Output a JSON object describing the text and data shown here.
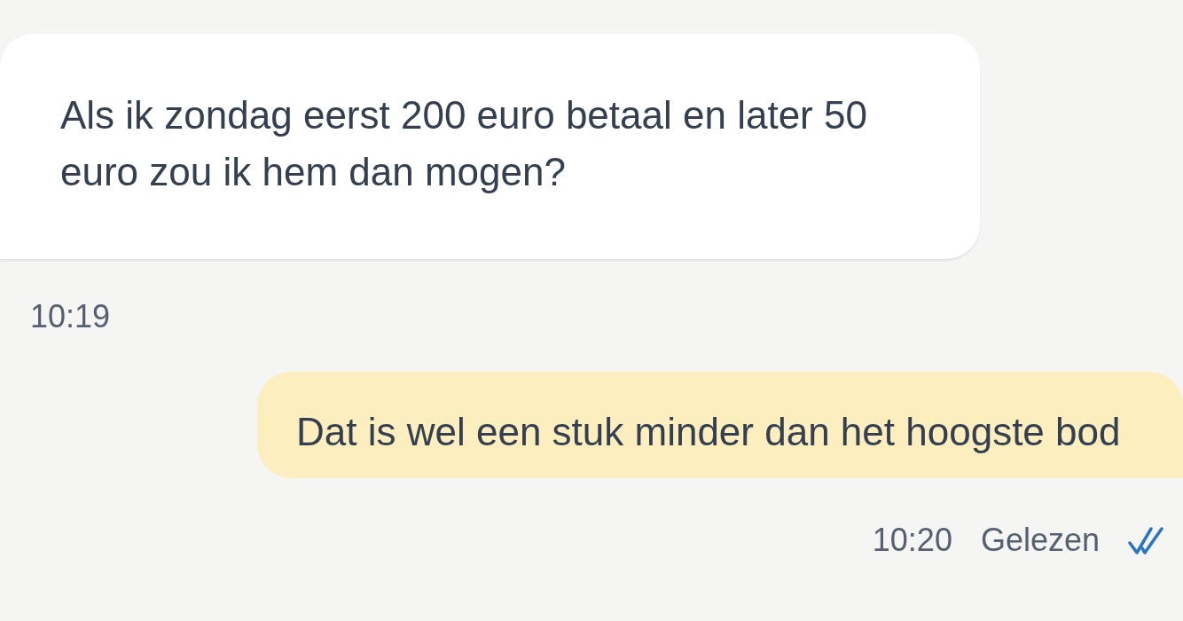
{
  "messages": [
    {
      "kind": "incoming",
      "text": "Als ik zondag eerst 200 euro betaal en later 50 euro zou ik hem dan mogen?",
      "time": "10:19"
    },
    {
      "kind": "outgoing",
      "text": "Dat is wel een stuk minder dan het hoogste bod",
      "time": "10:20",
      "status": "Gelezen",
      "read": true
    }
  ]
}
